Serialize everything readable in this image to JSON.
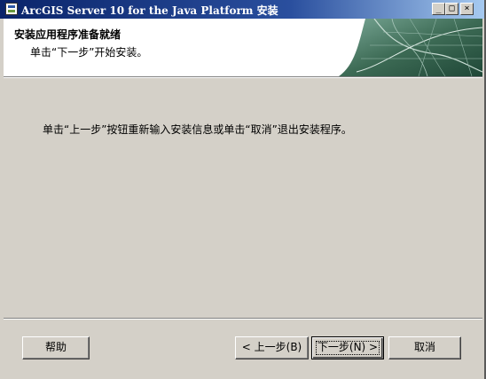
{
  "window": {
    "title": "ArcGIS Server 10 for the Java Platform 安装",
    "controls": {
      "minimize": "_",
      "maximize": "□",
      "close": "×"
    }
  },
  "header": {
    "title": "安装应用程序准备就绪",
    "subtitle": "单击“下一步”开始安装。"
  },
  "body": {
    "message": "单击“上一步”按钮重新输入安装信息或单击“取消”退出安装程序。"
  },
  "buttons": {
    "help": "帮助",
    "back": "< 上一步(B)",
    "next": "下一步(N) >",
    "cancel": "取消"
  },
  "colors": {
    "titlebar_start": "#0a246a",
    "titlebar_end": "#a6caf0",
    "dialog_bg": "#d4d0c8",
    "header_bg": "#ffffff",
    "art_green": "#3d6b55"
  }
}
